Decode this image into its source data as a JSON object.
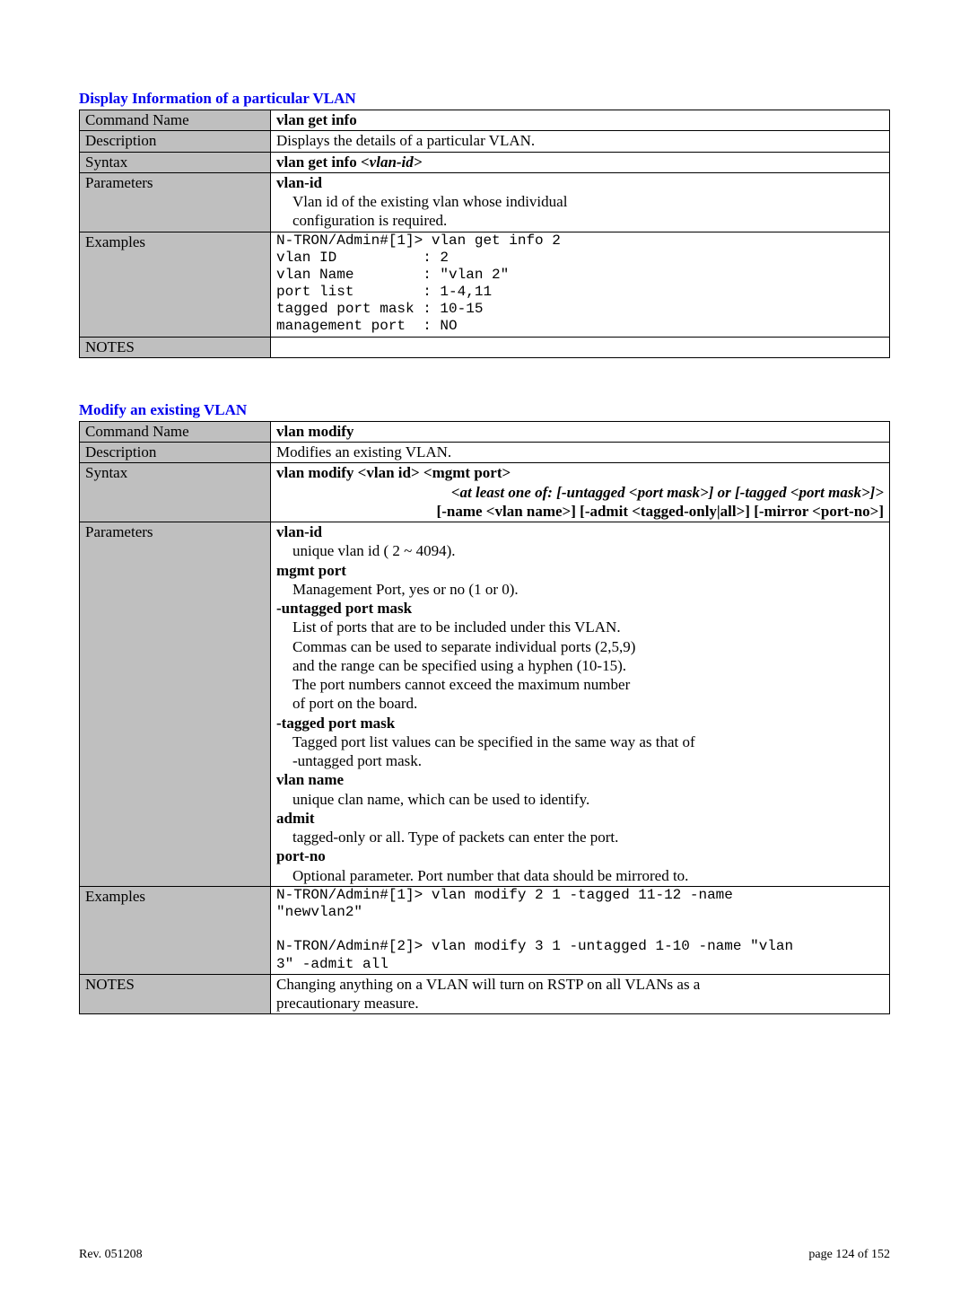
{
  "section1": {
    "title": "Display Information of a particular VLAN",
    "rows": {
      "commandName": {
        "label": "Command Name",
        "value": "vlan get info"
      },
      "description": {
        "label": "Description",
        "value": "Displays the details of a particular VLAN."
      },
      "syntax": {
        "label": "Syntax",
        "bold": "vlan get info ",
        "italic": "<vlan-id>"
      },
      "parameters": {
        "label": "Parameters",
        "name": "vlan-id",
        "desc1": "Vlan id of the existing vlan whose individual",
        "desc2": "configuration is required."
      },
      "examples": {
        "label": "Examples",
        "text": "N-TRON/Admin#[1]> vlan get info 2\nvlan ID          : 2\nvlan Name        : \"vlan 2\"\nport list        : 1-4,11\ntagged port mask : 10-15\nmanagement port  : NO"
      },
      "notes": {
        "label": "NOTES",
        "value": ""
      }
    }
  },
  "section2": {
    "title": "Modify an existing VLAN",
    "rows": {
      "commandName": {
        "label": "Command Name",
        "value": "vlan modify"
      },
      "description": {
        "label": "Description",
        "value": "Modifies an existing VLAN."
      },
      "syntax": {
        "label": "Syntax",
        "line1": "vlan modify <vlan id> <mgmt port>",
        "line2": "<at least one of: [-untagged <port mask>] or  [-tagged <port mask>]>",
        "line3": "[-name <vlan name>] [-admit <tagged-only|all>] [-mirror <port-no>]"
      },
      "parameters": {
        "label": "Parameters",
        "p1": {
          "name": "vlan-id",
          "d1": "unique vlan id ( 2 ~ 4094)."
        },
        "p2": {
          "name": "mgmt port",
          "d1": "Management Port, yes or no (1 or 0)."
        },
        "p3": {
          "name": "-untagged port mask",
          "d1": "List of ports that are to be included under this VLAN.",
          "d2": "Commas can be used to separate individual ports (2,5,9)",
          "d3": "and the range can be specified using a hyphen (10-15).",
          "d4": "The port numbers cannot exceed the maximum number",
          "d5": "of port on the board."
        },
        "p4": {
          "name": "-tagged port mask",
          "d1": "Tagged port list values can be specified in the same way as that of",
          "d2": "-untagged port mask."
        },
        "p5": {
          "name": "vlan name",
          "d1": "unique clan name, which can be used to identify."
        },
        "p6": {
          "name": "admit",
          "d1": "tagged-only or all.  Type of packets can enter the port."
        },
        "p7": {
          "name": "port-no",
          "d1": "Optional parameter. Port number that data should be mirrored to."
        }
      },
      "examples": {
        "label": "Examples",
        "text": "N-TRON/Admin#[1]> vlan modify 2 1 -tagged 11-12 -name\n\"newvlan2\"\n\nN-TRON/Admin#[2]> vlan modify 3 1 -untagged 1-10 -name \"vlan\n3\" -admit all"
      },
      "notes": {
        "label": "NOTES",
        "d1": "Changing anything on a VLAN will turn on RSTP on all VLANs as a",
        "d2": "precautionary measure."
      }
    }
  },
  "footer": {
    "rev": "Rev.  051208",
    "page": "page 124 of 152"
  }
}
